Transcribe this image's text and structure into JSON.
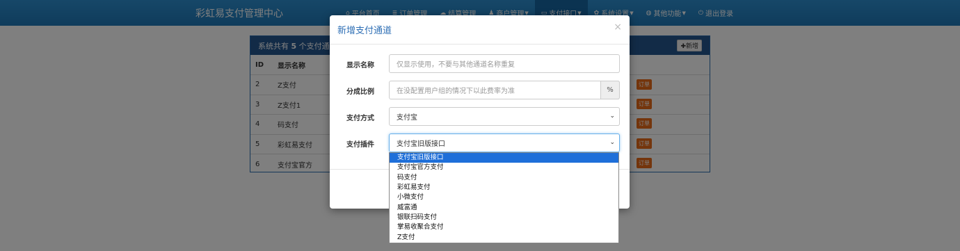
{
  "brand": "彩虹易支付管理中心",
  "nav": [
    {
      "icon": "home-icon",
      "glyph": "⌂",
      "label": "平台首页",
      "caret": false,
      "active": false
    },
    {
      "icon": "list-icon",
      "glyph": "≣",
      "label": "订单管理",
      "caret": false,
      "active": false
    },
    {
      "icon": "cloud-icon",
      "glyph": "☁",
      "label": "结算管理",
      "caret": false,
      "active": false
    },
    {
      "icon": "user-icon",
      "glyph": "♟",
      "label": "商户管理",
      "caret": true,
      "active": false
    },
    {
      "icon": "card-icon",
      "glyph": "▭",
      "label": "支付接口",
      "caret": true,
      "active": true
    },
    {
      "icon": "gear-icon",
      "glyph": "✿",
      "label": "系统设置",
      "caret": true,
      "active": false
    },
    {
      "icon": "globe-icon",
      "glyph": "◍",
      "label": "其他功能",
      "caret": true,
      "active": false
    },
    {
      "icon": "power-icon",
      "glyph": "⏻",
      "label": "退出登录",
      "caret": false,
      "active": false
    }
  ],
  "panel": {
    "heading_prefix": "系统共有 ",
    "count": "5",
    "heading_suffix": " 个支付通",
    "add_label": "新增",
    "columns": {
      "id": "ID",
      "name": "显示名称"
    },
    "rows": [
      {
        "id": "2",
        "name": "Z支付"
      },
      {
        "id": "3",
        "name": "Z支付1"
      },
      {
        "id": "4",
        "name": "码支付"
      },
      {
        "id": "5",
        "name": "彩虹易支付"
      },
      {
        "id": "6",
        "name": "支付宝官方"
      }
    ],
    "order_label": "订单"
  },
  "modal": {
    "title": "新增支付通道",
    "close": "×",
    "fields": {
      "name_label": "显示名称",
      "name_placeholder": "仅显示使用，不要与其他通道名称重复",
      "rate_label": "分成比例",
      "rate_placeholder": "在没配置用户组的情况下以此费率为准",
      "rate_addon": "%",
      "type_label": "支付方式",
      "type_value": "支付宝",
      "plugin_label": "支付插件",
      "plugin_value": "支付宝旧版接口"
    }
  },
  "plugin_options": [
    "支付宝旧版接口",
    "支付宝官方支付",
    "码支付",
    "彩虹易支付",
    "小微支付",
    "威富通",
    "银联扫码支付",
    "掌易收聚合支付",
    "Z支付"
  ],
  "plugin_selected_index": 0
}
